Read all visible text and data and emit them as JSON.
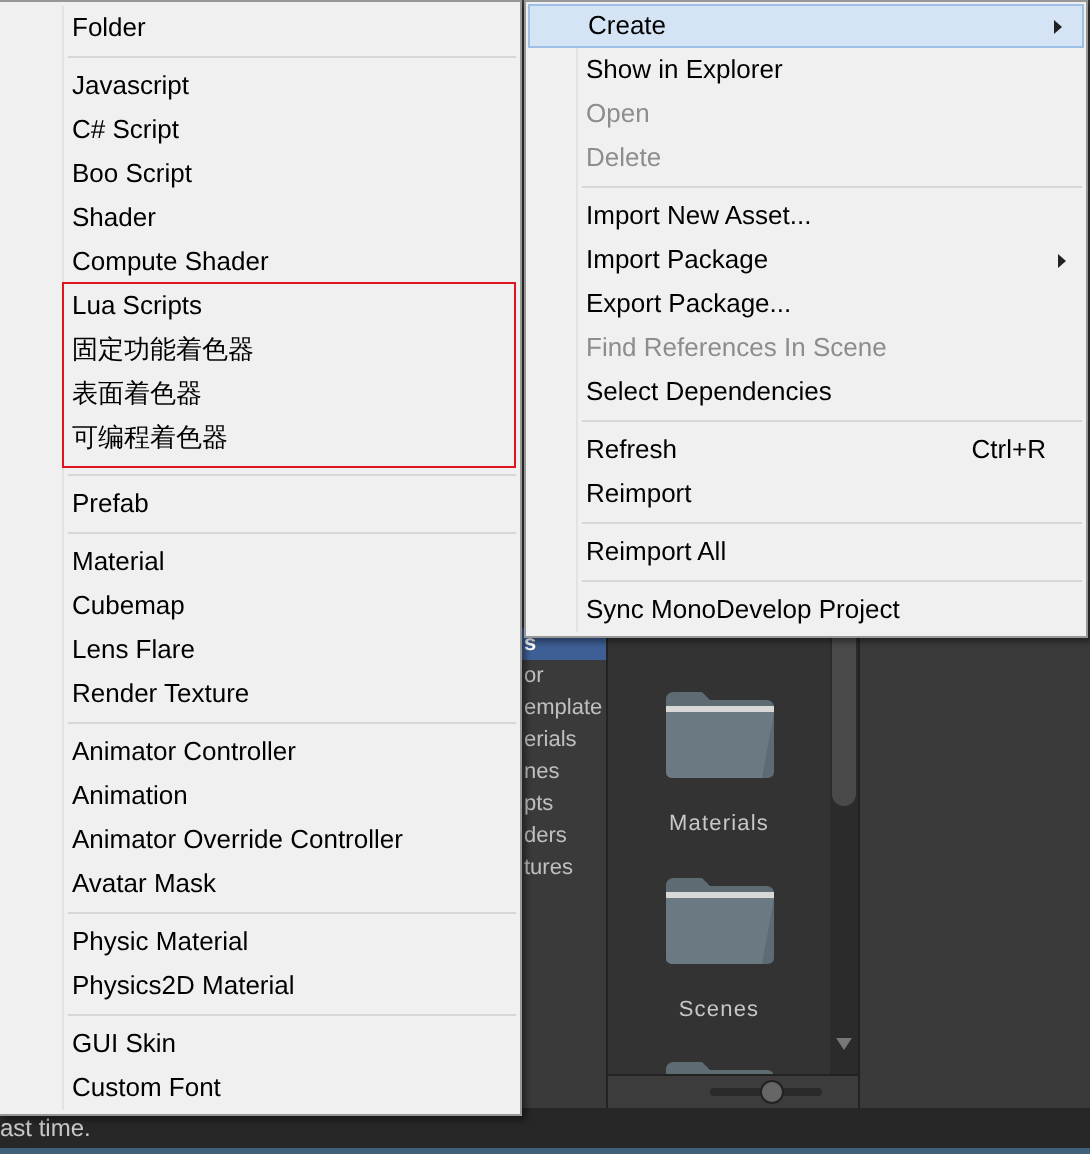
{
  "sidebar": {
    "items": [
      {
        "label": "s",
        "selected": true
      },
      {
        "label": "or",
        "selected": false
      },
      {
        "label": "emplate",
        "selected": false
      },
      {
        "label": "erials",
        "selected": false
      },
      {
        "label": "nes",
        "selected": false
      },
      {
        "label": "pts",
        "selected": false
      },
      {
        "label": "ders",
        "selected": false
      },
      {
        "label": "tures",
        "selected": false
      }
    ]
  },
  "assets": {
    "items": [
      {
        "kind": "folder",
        "label": "Materials"
      },
      {
        "kind": "folder",
        "label": "Scenes"
      },
      {
        "kind": "folder"
      }
    ]
  },
  "zoom_slider": {
    "level": 0.55
  },
  "status_bar": {
    "text": "ast time."
  },
  "create_submenu": {
    "items": [
      {
        "kind": "item",
        "label": "Folder",
        "outlined": false
      },
      {
        "kind": "separator"
      },
      {
        "kind": "item",
        "label": "Javascript",
        "outlined": false
      },
      {
        "kind": "item",
        "label": "C# Script",
        "outlined": false
      },
      {
        "kind": "item",
        "label": "Boo Script",
        "outlined": false
      },
      {
        "kind": "item",
        "label": "Shader",
        "outlined": false
      },
      {
        "kind": "item",
        "label": "Compute Shader",
        "outlined": false
      },
      {
        "kind": "item",
        "label": "Lua Scripts",
        "outlined": true
      },
      {
        "kind": "item",
        "label": "固定功能着色器",
        "outlined": true
      },
      {
        "kind": "item",
        "label": "表面着色器",
        "outlined": true
      },
      {
        "kind": "item",
        "label": "可编程着色器",
        "outlined": true
      },
      {
        "kind": "separator"
      },
      {
        "kind": "item",
        "label": "Prefab",
        "outlined": false
      },
      {
        "kind": "separator"
      },
      {
        "kind": "item",
        "label": "Material",
        "outlined": false
      },
      {
        "kind": "item",
        "label": "Cubemap",
        "outlined": false
      },
      {
        "kind": "item",
        "label": "Lens Flare",
        "outlined": false
      },
      {
        "kind": "item",
        "label": "Render Texture",
        "outlined": false
      },
      {
        "kind": "separator"
      },
      {
        "kind": "item",
        "label": "Animator Controller",
        "outlined": false
      },
      {
        "kind": "item",
        "label": "Animation",
        "outlined": false
      },
      {
        "kind": "item",
        "label": "Animator Override Controller",
        "outlined": false
      },
      {
        "kind": "item",
        "label": "Avatar Mask",
        "outlined": false
      },
      {
        "kind": "separator"
      },
      {
        "kind": "item",
        "label": "Physic Material",
        "outlined": false
      },
      {
        "kind": "item",
        "label": "Physics2D Material",
        "outlined": false
      },
      {
        "kind": "separator"
      },
      {
        "kind": "item",
        "label": "GUI Skin",
        "outlined": false
      },
      {
        "kind": "item",
        "label": "Custom Font",
        "outlined": false
      }
    ]
  },
  "context_menu": {
    "items": [
      {
        "kind": "item",
        "label": "Create",
        "selected": true,
        "disabled": false,
        "submenu": true
      },
      {
        "kind": "item",
        "label": "Show in Explorer",
        "selected": false,
        "disabled": false,
        "submenu": false
      },
      {
        "kind": "item",
        "label": "Open",
        "selected": false,
        "disabled": true,
        "submenu": false
      },
      {
        "kind": "item",
        "label": "Delete",
        "selected": false,
        "disabled": true,
        "submenu": false
      },
      {
        "kind": "separator"
      },
      {
        "kind": "item",
        "label": "Import New Asset...",
        "selected": false,
        "disabled": false,
        "submenu": false
      },
      {
        "kind": "item",
        "label": "Import Package",
        "selected": false,
        "disabled": false,
        "submenu": true
      },
      {
        "kind": "item",
        "label": "Export Package...",
        "selected": false,
        "disabled": false,
        "submenu": false
      },
      {
        "kind": "item",
        "label": "Find References In Scene",
        "selected": false,
        "disabled": true,
        "submenu": false
      },
      {
        "kind": "item",
        "label": "Select Dependencies",
        "selected": false,
        "disabled": false,
        "submenu": false
      },
      {
        "kind": "separator"
      },
      {
        "kind": "item",
        "label": "Refresh",
        "shortcut": "Ctrl+R",
        "selected": false,
        "disabled": false,
        "submenu": false
      },
      {
        "kind": "item",
        "label": "Reimport",
        "selected": false,
        "disabled": false,
        "submenu": false
      },
      {
        "kind": "separator"
      },
      {
        "kind": "item",
        "label": "Reimport All",
        "selected": false,
        "disabled": false,
        "submenu": false
      },
      {
        "kind": "separator"
      },
      {
        "kind": "item",
        "label": "Sync MonoDevelop Project",
        "selected": false,
        "disabled": false,
        "submenu": false
      }
    ]
  }
}
